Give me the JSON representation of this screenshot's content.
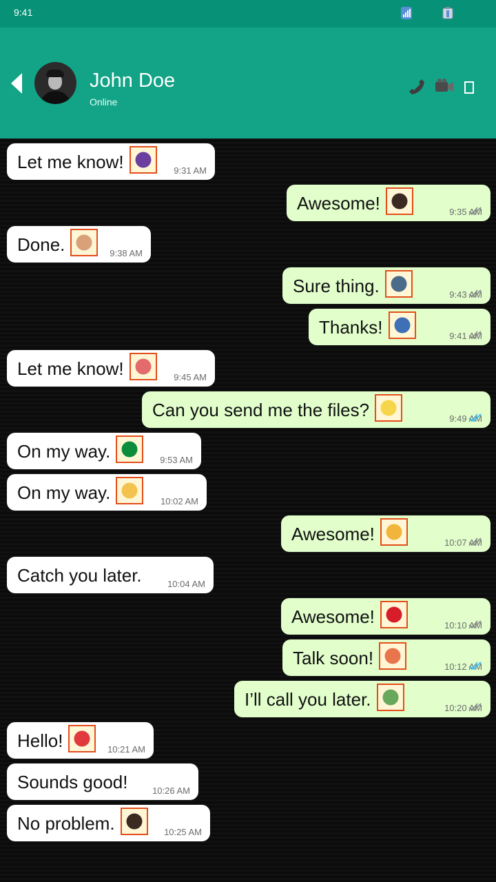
{
  "status_bar": {
    "time": "9:41"
  },
  "header": {
    "name": "John Doe",
    "status": "Online"
  },
  "messages": [
    {
      "dir": "in",
      "text": "Let me know!",
      "time": "9:31 AM",
      "emoji": "ninja-emoji"
    },
    {
      "dir": "out",
      "text": "Awesome!",
      "time": "9:35 AM",
      "emoji": "health-worker-emoji",
      "read": false
    },
    {
      "dir": "in",
      "text": "Done.",
      "time": "9:38 AM",
      "emoji": "person-in-steamy-room-emoji"
    },
    {
      "dir": "out",
      "text": "Sure thing.",
      "time": "9:43 AM",
      "emoji": "technologist-emoji",
      "read": false
    },
    {
      "dir": "out",
      "text": "Thanks!",
      "time": "9:41 AM",
      "emoji": "motorized-wheelchair-person-emoji",
      "read": false
    },
    {
      "dir": "in",
      "text": "Let me know!",
      "time": "9:45 AM",
      "emoji": "couple-with-heart-emoji"
    },
    {
      "dir": "out",
      "text": "Can you send me the files?",
      "time": "9:49 AM",
      "emoji": "face-with-medical-mask-emoji",
      "read": true
    },
    {
      "dir": "in",
      "text": "On my way.",
      "time": "9:53 AM",
      "emoji": "flag-kuwait-emoji"
    },
    {
      "dir": "in",
      "text": "On my way.",
      "time": "10:02 AM",
      "emoji": "hairdresser-emoji"
    },
    {
      "dir": "out",
      "text": "Awesome!",
      "time": "10:07 AM",
      "emoji": "family-emoji",
      "read": false
    },
    {
      "dir": "in",
      "text": "Catch you later.",
      "time": "10:04 AM",
      "emoji": ""
    },
    {
      "dir": "out",
      "text": "Awesome!",
      "time": "10:10 AM",
      "emoji": "person-in-tuxedo-emoji",
      "read": false
    },
    {
      "dir": "out",
      "text": "Talk soon!",
      "time": "10:12 AM",
      "emoji": "drop-of-blood-emoji",
      "read": true
    },
    {
      "dir": "out",
      "text": "I’ll call you later.",
      "time": "10:20 AM",
      "emoji": "person-bouncing-ball-emoji",
      "read": false
    },
    {
      "dir": "in",
      "text": "Hello!",
      "time": "10:21 AM",
      "emoji": "person-playing-handball-emoji"
    },
    {
      "dir": "in",
      "text": "Sounds good!",
      "time": "10:26 AM",
      "emoji": ""
    },
    {
      "dir": "in",
      "text": "No problem.",
      "time": "10:25 AM",
      "emoji": "flag-peru-emoji"
    }
  ]
}
